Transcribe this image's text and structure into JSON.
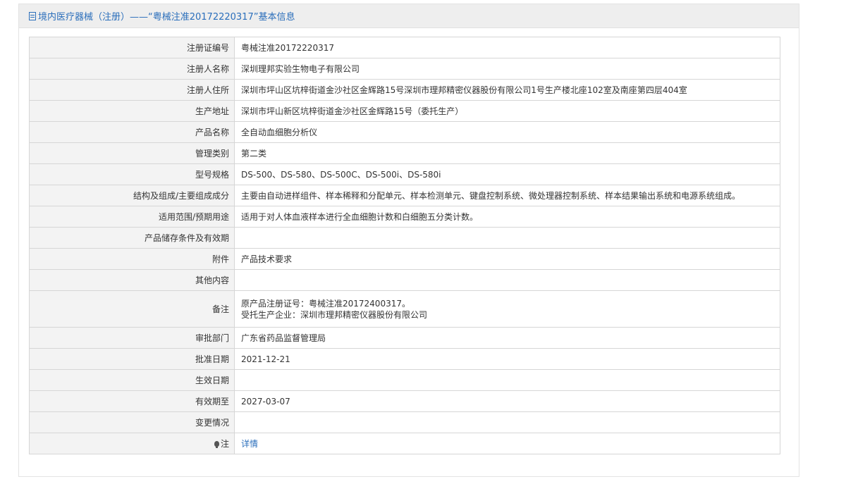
{
  "header": {
    "icon": "document-icon",
    "title": "境内医疗器械（注册）——“粤械注准20172220317”基本信息"
  },
  "rows": [
    {
      "label": "注册证编号",
      "value": "粤械注准20172220317"
    },
    {
      "label": "注册人名称",
      "value": "深圳理邦实验生物电子有限公司"
    },
    {
      "label": "注册人住所",
      "value": "深圳市坪山区坑梓街道金沙社区金辉路15号深圳市理邦精密仪器股份有限公司1号生产楼北座102室及南座第四层404室"
    },
    {
      "label": "生产地址",
      "value": "深圳市坪山新区坑梓街道金沙社区金辉路15号（委托生产）"
    },
    {
      "label": "产品名称",
      "value": "全自动血细胞分析仪"
    },
    {
      "label": "管理类别",
      "value": "第二类"
    },
    {
      "label": "型号规格",
      "value": "DS-500、DS-580、DS-500C、DS-500i、DS-580i"
    },
    {
      "label": "结构及组成/主要组成成分",
      "value": "主要由自动进样组件、样本稀释和分配单元、样本检测单元、键盘控制系统、微处理器控制系统、样本结果输出系统和电源系统组成。"
    },
    {
      "label": "适用范围/预期用途",
      "value": "适用于对人体血液样本进行全血细胞计数和白细胞五分类计数。"
    },
    {
      "label": "产品储存条件及有效期",
      "value": ""
    },
    {
      "label": "附件",
      "value": "产品技术要求"
    },
    {
      "label": "其他内容",
      "value": ""
    }
  ],
  "remark": {
    "label": "备注",
    "line1": "原产品注册证号：粤械注准20172400317。",
    "line2": "受托生产企业：深圳市理邦精密仪器股份有限公司"
  },
  "rows2": [
    {
      "label": "审批部门",
      "value": "广东省药品监督管理局"
    },
    {
      "label": "批准日期",
      "value": "2021-12-21"
    },
    {
      "label": "生效日期",
      "value": ""
    },
    {
      "label": "有效期至",
      "value": "2027-03-07"
    },
    {
      "label": "变更情况",
      "value": ""
    }
  ],
  "note": {
    "icon": "lightbulb-icon",
    "label": "注",
    "link_text": "详情"
  },
  "colors": {
    "title": "#2a6ebb",
    "label_bg": "#f3f3f3",
    "border": "#d6d6d6",
    "link": "#2a6ebb"
  }
}
